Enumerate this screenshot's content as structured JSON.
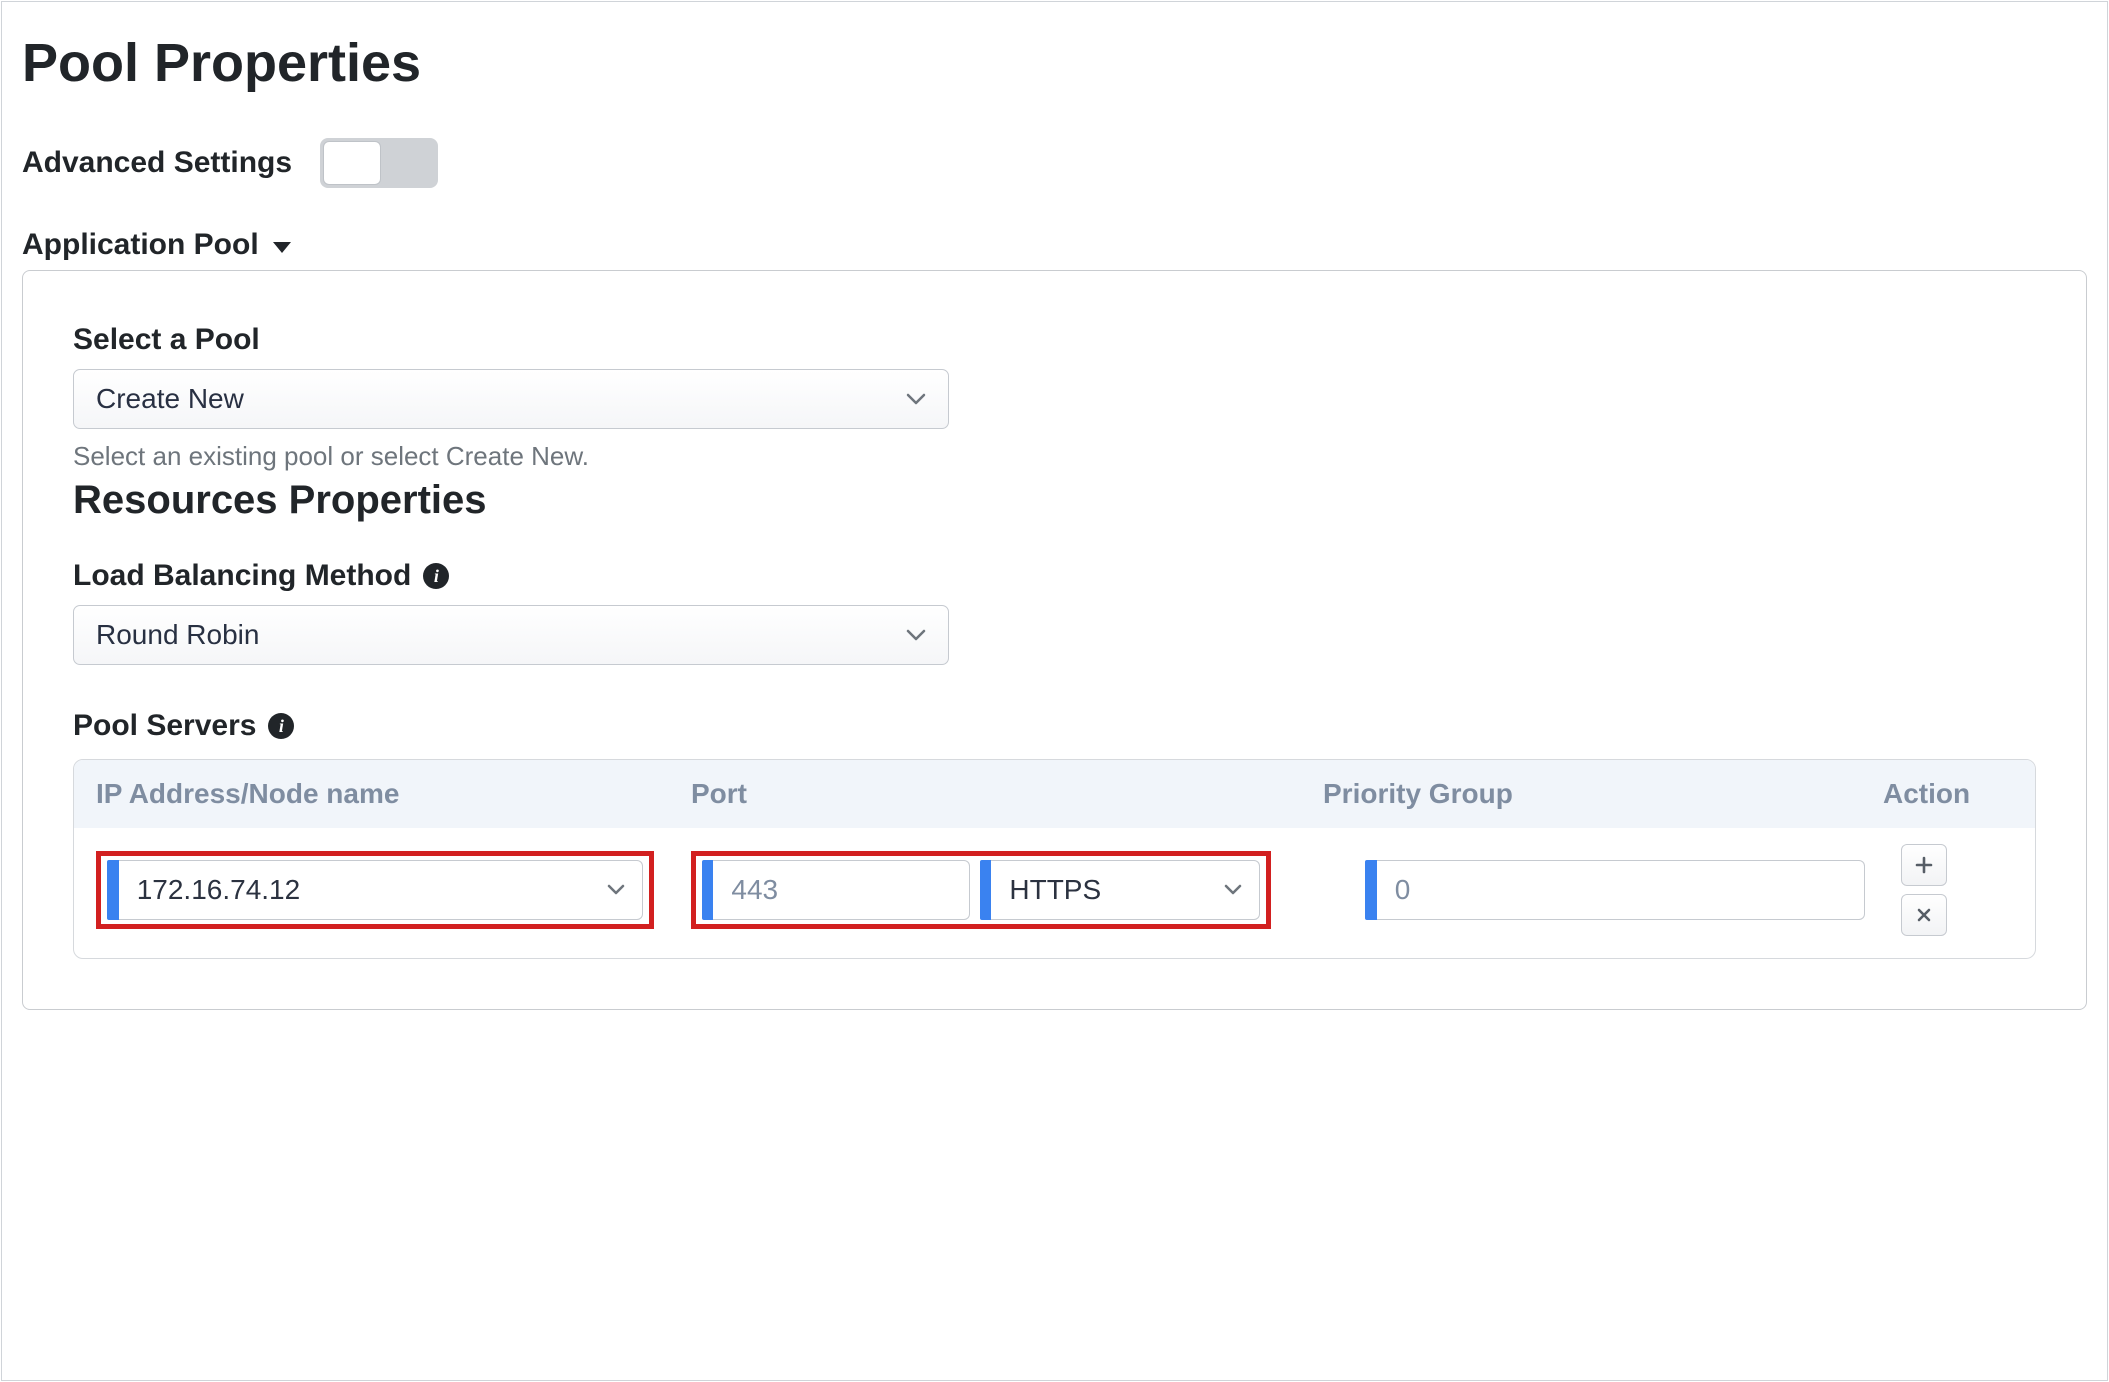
{
  "page_title": "Pool Properties",
  "advanced_settings_label": "Advanced Settings",
  "advanced_settings_on": false,
  "section": {
    "title": "Application Pool",
    "select_pool": {
      "label": "Select a Pool",
      "value": "Create New",
      "help": "Select an existing pool or select Create New."
    },
    "resources_title": "Resources Properties",
    "lb_method": {
      "label": "Load Balancing Method",
      "value": "Round Robin"
    },
    "pool_servers_label": "Pool Servers",
    "table": {
      "headers": {
        "ip": "IP Address/Node name",
        "port": "Port",
        "priority": "Priority Group",
        "action": "Action"
      },
      "row": {
        "ip": "172.16.74.12",
        "port": "443",
        "protocol": "HTTPS",
        "priority": "0"
      }
    }
  }
}
